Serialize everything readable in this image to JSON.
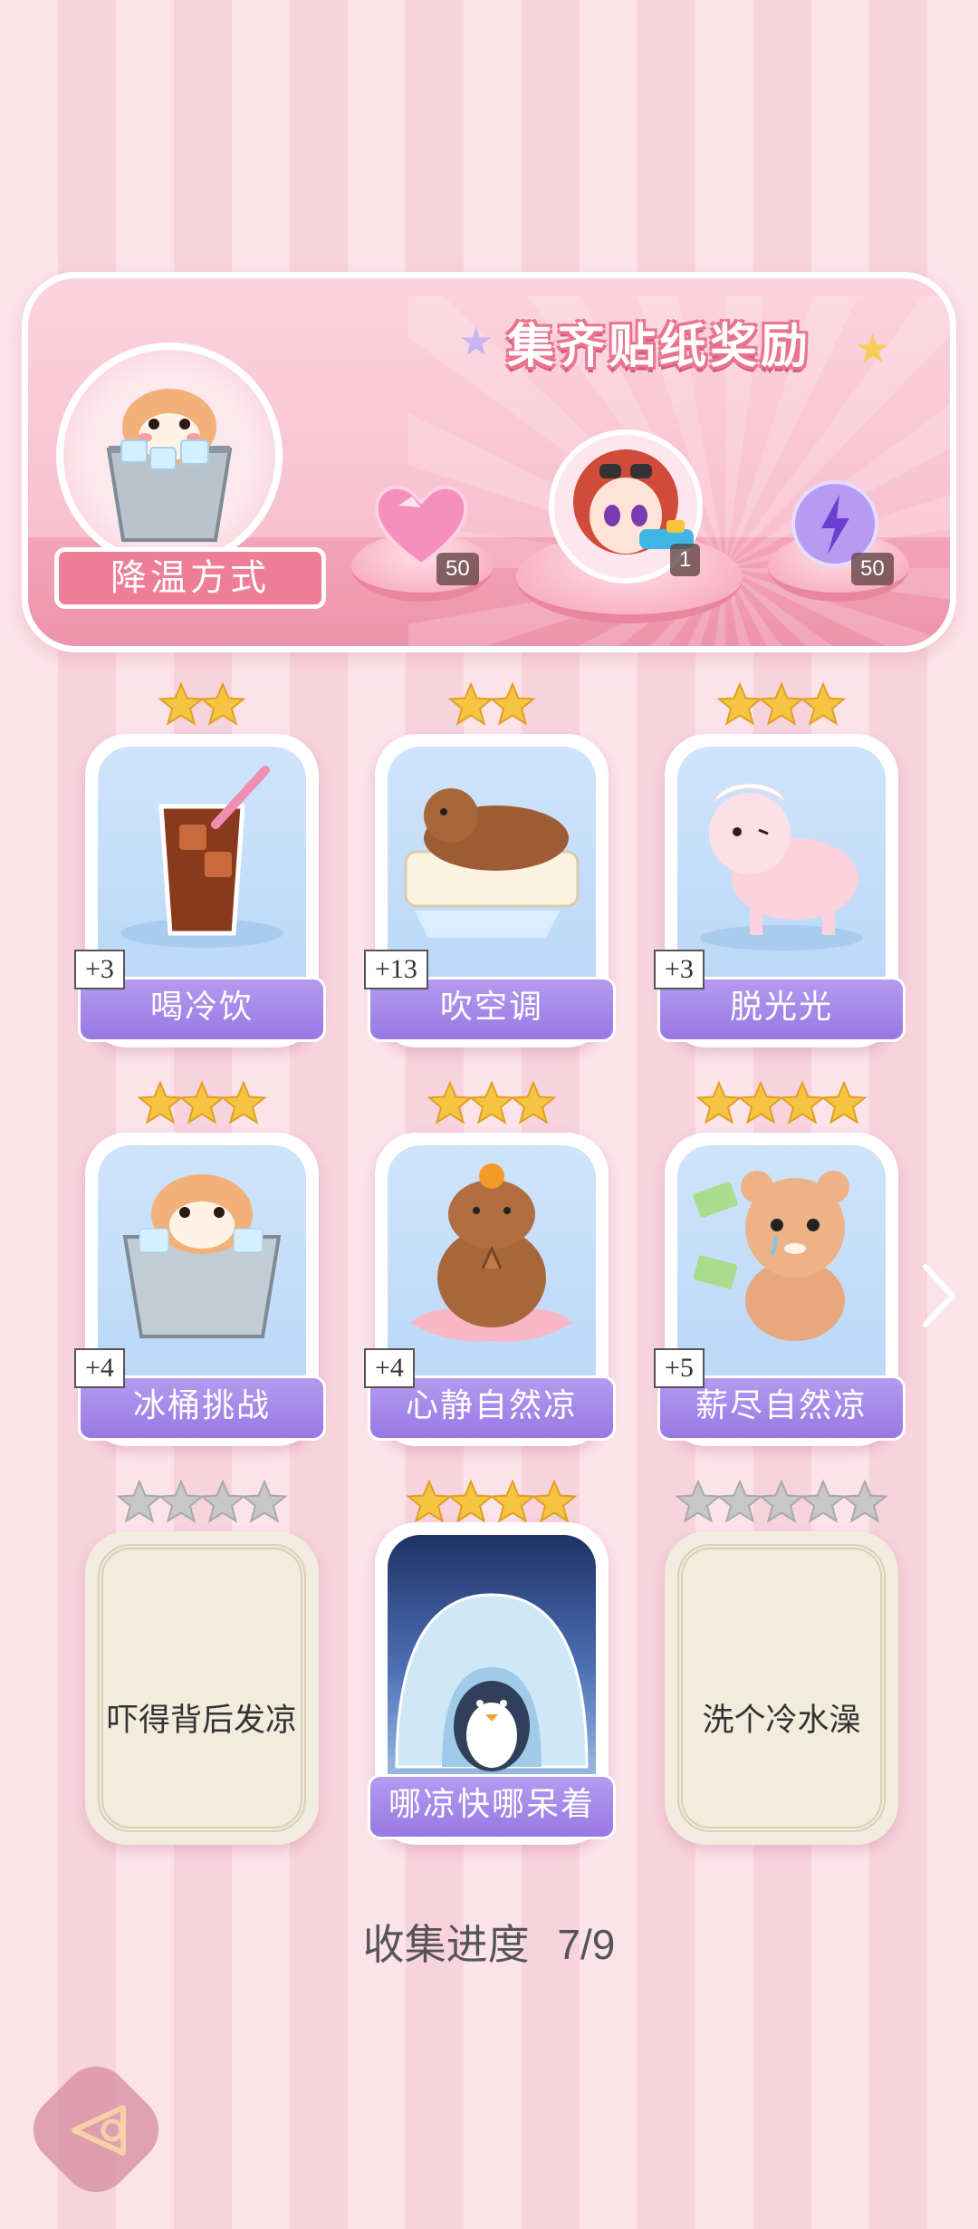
{
  "banner": {
    "title": "集齐贴纸奖励",
    "cooling_label": "降温方式",
    "rewards": [
      {
        "icon": "pink-diamond-heart-icon",
        "count": "50"
      },
      {
        "icon": "character-avatar-icon",
        "count": "1"
      },
      {
        "icon": "purple-energy-orb-icon",
        "count": "50"
      }
    ]
  },
  "cards": [
    {
      "name": "喝冷饮",
      "bonus": "+3",
      "stars_earned": 2,
      "stars_total": 2,
      "icon": "iced-drink-icon",
      "locked": false
    },
    {
      "name": "吹空调",
      "bonus": "+13",
      "stars_earned": 2,
      "stars_total": 2,
      "icon": "capybara-air-conditioner-icon",
      "locked": false
    },
    {
      "name": "脱光光",
      "bonus": "+3",
      "stars_earned": 3,
      "stars_total": 3,
      "icon": "shorn-sheep-icon",
      "locked": false
    },
    {
      "name": "冰桶挑战",
      "bonus": "+4",
      "stars_earned": 3,
      "stars_total": 3,
      "icon": "hamster-ice-bucket-icon",
      "locked": false
    },
    {
      "name": "心静自然凉",
      "bonus": "+4",
      "stars_earned": 3,
      "stars_total": 3,
      "icon": "meditating-capybara-icon",
      "locked": false
    },
    {
      "name": "薪尽自然凉",
      "bonus": "+5",
      "stars_earned": 4,
      "stars_total": 4,
      "icon": "crying-bear-money-icon",
      "locked": false
    },
    {
      "name": "吓得背后发凉",
      "bonus": "",
      "stars_earned": 0,
      "stars_total": 4,
      "icon": "",
      "locked": true
    },
    {
      "name": "哪凉快哪呆着",
      "bonus": "",
      "stars_earned": 4,
      "stars_total": 4,
      "icon": "penguin-igloo-icon",
      "locked": false,
      "special": true
    },
    {
      "name": "洗个冷水澡",
      "bonus": "",
      "stars_earned": 0,
      "stars_total": 5,
      "icon": "",
      "locked": true
    }
  ],
  "progress": {
    "label": "收集进度",
    "value": "7/9"
  },
  "colors": {
    "accent_pink": "#ee7d98",
    "card_label_purple": "#9878e4",
    "star_gold": "#f6c443",
    "star_grey": "#c7c7c7"
  }
}
